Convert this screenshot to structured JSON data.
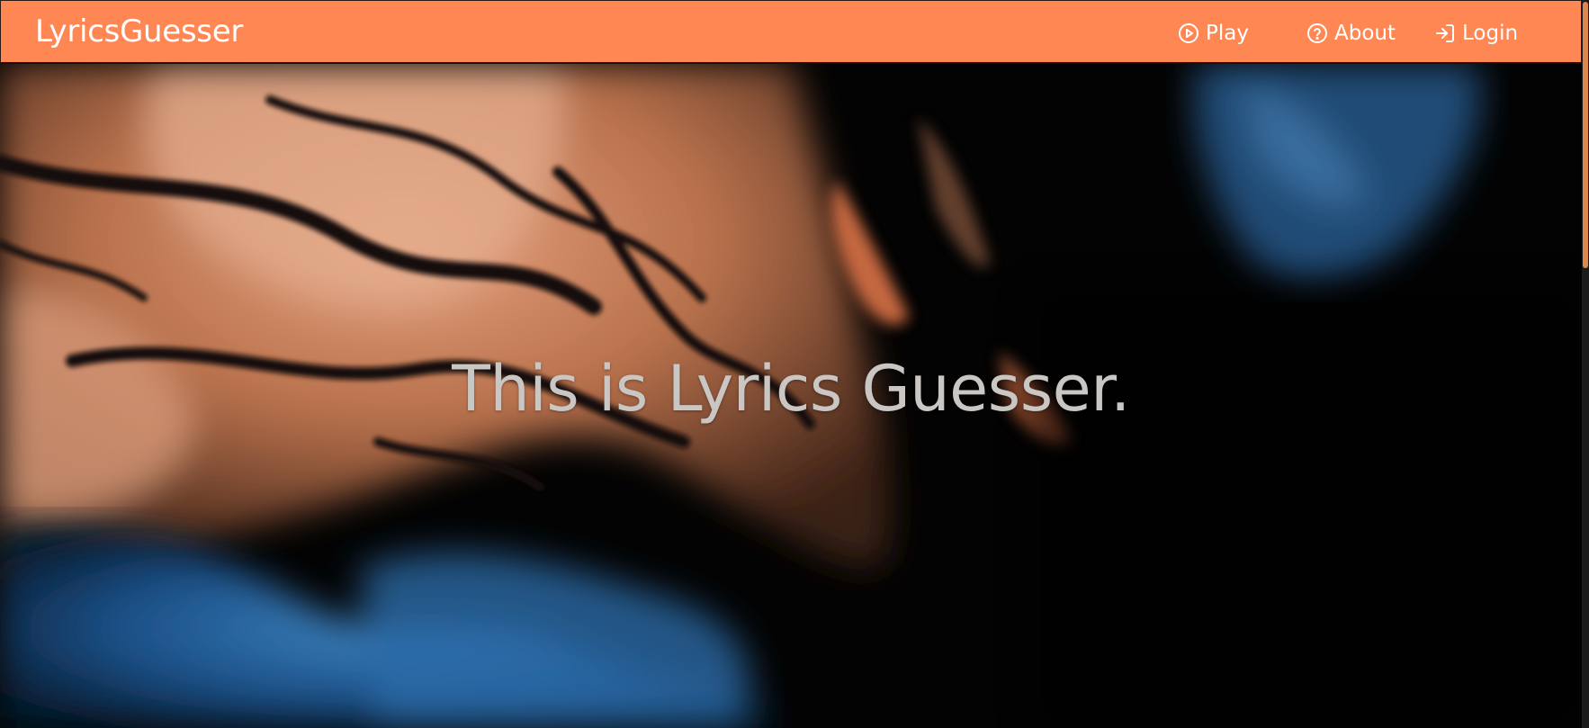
{
  "app": {
    "brand": "LyricsGuesser",
    "accent_color": "#ff8753"
  },
  "nav": {
    "items": [
      {
        "label": "Play",
        "icon": "play-circle-icon"
      },
      {
        "label": "About",
        "icon": "question-circle-icon"
      },
      {
        "label": "Login",
        "icon": "login-arrow-icon"
      }
    ]
  },
  "hero": {
    "title": "This is Lyrics Guesser.",
    "background": "abstract fluid paint in copper, black and blue"
  }
}
